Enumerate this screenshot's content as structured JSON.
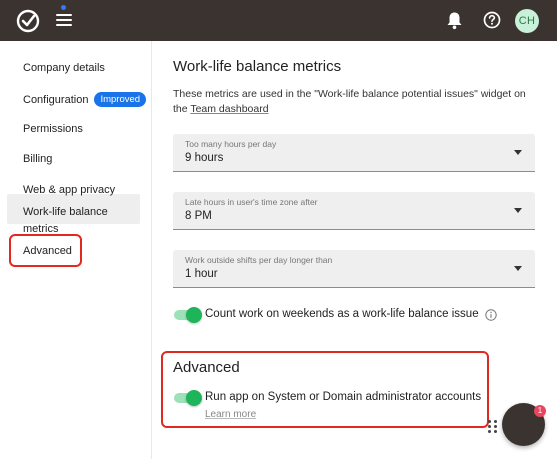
{
  "topbar": {
    "logo_icon": "checkmark-logo",
    "menu_icon": "hamburger-icon",
    "bell_icon": "bell-icon",
    "help_icon": "help-icon",
    "avatar_initials": "CH"
  },
  "sidebar": {
    "items": [
      {
        "label": "Company details"
      },
      {
        "label": "Configuration",
        "badge": "Improved"
      },
      {
        "label": "Permissions"
      },
      {
        "label": "Billing"
      },
      {
        "label": "Web & app privacy"
      },
      {
        "label": "Work-life balance"
      },
      {
        "label": "metrics"
      },
      {
        "label": "Advanced"
      }
    ]
  },
  "main": {
    "title": "Work-life balance metrics",
    "description_part1": "These metrics are used in the \"Work-life balance potential issues\" widget on the ",
    "description_link": "Team dashboard",
    "selects": [
      {
        "label": "Too many hours per day",
        "value": "9 hours"
      },
      {
        "label": "Late hours in user's time zone after",
        "value": "8 PM"
      },
      {
        "label": "Work outside shifts per day longer than",
        "value": "1 hour"
      }
    ],
    "weekend_toggle": {
      "label": "Count work on weekends as a work-life balance issue",
      "on": true
    },
    "advanced": {
      "title": "Advanced",
      "toggle_label": "Run app on System or Domain administrator accounts",
      "learn_more": "Learn more",
      "on": true
    }
  },
  "chat": {
    "badge_count": "1"
  },
  "colors": {
    "topbar": "#3b3330",
    "accent_blue": "#1a73e8",
    "toggle_green": "#1eb45a",
    "highlight_red": "#e02a20"
  }
}
